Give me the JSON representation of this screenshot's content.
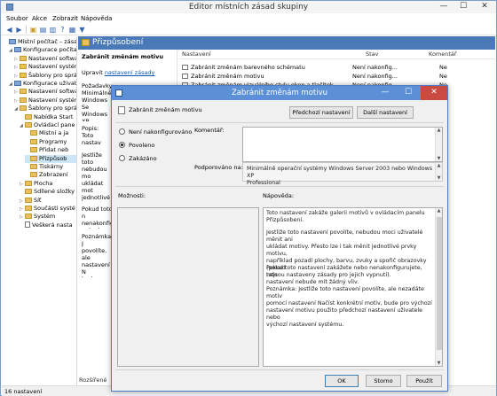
{
  "app": {
    "title": "Editor místních zásad skupiny",
    "controls": {
      "minimize": "—",
      "maximize": "☐",
      "close": "✕"
    }
  },
  "menu": [
    "Soubor",
    "Akce",
    "Zobrazit",
    "Nápověda"
  ],
  "toolbar": {
    "icons": [
      "back-icon",
      "forward-icon",
      "folder-up-icon",
      "show-hide-tree-icon",
      "export-icon",
      "help-icon",
      "properties-icon",
      "filter-icon"
    ]
  },
  "tree": {
    "items": [
      {
        "label": "Místní počítač – zásady",
        "indent": 0,
        "expander": "",
        "icon": "computer"
      },
      {
        "label": "Konfigurace počítač",
        "indent": 1,
        "expander": "◢",
        "icon": "computer"
      },
      {
        "label": "Nastavení softwa",
        "indent": 2,
        "expander": "▷",
        "icon": "folder"
      },
      {
        "label": "Nastavení systém",
        "indent": 2,
        "expander": "▷",
        "icon": "folder"
      },
      {
        "label": "Šablony pro sprá",
        "indent": 2,
        "expander": "▷",
        "icon": "folder"
      },
      {
        "label": "Konfigurace uživatele",
        "indent": 1,
        "expander": "◢",
        "icon": "computer"
      },
      {
        "label": "Nastavení softwa",
        "indent": 2,
        "expander": "▷",
        "icon": "folder"
      },
      {
        "label": "Nastavení systém",
        "indent": 2,
        "expander": "▷",
        "icon": "folder"
      },
      {
        "label": "Šablony pro sprá",
        "indent": 2,
        "expander": "◢",
        "icon": "folder"
      },
      {
        "label": "Nabídka Start",
        "indent": 3,
        "expander": "",
        "icon": "folder"
      },
      {
        "label": "Ovládací pane",
        "indent": 3,
        "expander": "◢",
        "icon": "folder"
      },
      {
        "label": "Místní a ja",
        "indent": 4,
        "expander": "",
        "icon": "folder"
      },
      {
        "label": "Programy",
        "indent": 4,
        "expander": "",
        "icon": "folder"
      },
      {
        "label": "Přidat neb",
        "indent": 4,
        "expander": "",
        "icon": "folder"
      },
      {
        "label": "Přizpůsob",
        "indent": 4,
        "expander": "",
        "icon": "folder",
        "selected": true
      },
      {
        "label": "Tiskárny",
        "indent": 4,
        "expander": "",
        "icon": "folder"
      },
      {
        "label": "Zobrazení",
        "indent": 4,
        "expander": "",
        "icon": "folder"
      },
      {
        "label": "Plocha",
        "indent": 3,
        "expander": "▷",
        "icon": "folder"
      },
      {
        "label": "Sdílené složky",
        "indent": 3,
        "expander": "",
        "icon": "folder"
      },
      {
        "label": "Síť",
        "indent": 3,
        "expander": "▷",
        "icon": "folder"
      },
      {
        "label": "Součásti systé",
        "indent": 3,
        "expander": "▷",
        "icon": "folder"
      },
      {
        "label": "Systém",
        "indent": 3,
        "expander": "▷",
        "icon": "folder"
      },
      {
        "label": "Veškerá nasta",
        "indent": 3,
        "expander": "",
        "icon": "doc"
      }
    ]
  },
  "pane": {
    "header": "Přizpůsobení",
    "desc_title": "Zabránit změnám motivu",
    "desc_link_prefix": "Upravit ",
    "desc_link": "nastavení zásady",
    "desc_requirements": "Požadavky:\nMinimálně\nWindows Se\nWindows XP\nProfessiona",
    "desc_popis": "Popis:\nToto nastav\nv ovládacím",
    "desc_more": "Jestliže toto\nnebudou mo\nukládat mot\njednotlivé p\npozadí ploch\nobrazovky (\nzásady pro j",
    "desc_more2": "Pokud toto n\nnenakonfigu\nnebude mít",
    "desc_note": "Poznámka: J\npovolíte, ale\nnastavení N\nbude pro vý\npoužito přec\nnebo výchoz",
    "columns": {
      "setting": "Nastavení",
      "state": "Stav",
      "comment": "Komentář"
    },
    "rows": [
      {
        "setting": "Zabránit změnám barevného schématu",
        "state": "Není nakonfig...",
        "comment": "Ne"
      },
      {
        "setting": "Zabránit změnám motivu",
        "state": "Není nakonfig...",
        "comment": "Ne"
      },
      {
        "setting": "Zabránit změnám vizuálního stylu oken a tlačítek",
        "state": "Není nakonfig...",
        "comment": "Ne"
      }
    ],
    "bottom_tab": "Rozšířené"
  },
  "status": "16 nastavení",
  "dialog": {
    "title": "Zabránit změnám motivu",
    "subtitle": "Zabránit změnám motivu",
    "btn_prev": "Předchozí nastavení",
    "btn_next": "Další nastavení",
    "radio_not_configured": "Není nakonfigurováno",
    "radio_enabled": "Povoleno",
    "radio_disabled": "Zakázáno",
    "selected_radio": "Povoleno",
    "comment_label": "Komentář:",
    "supported_label": "Podporováno na:",
    "supported_text": "Minimálně operační systémy Windows Server 2003 nebo Windows XP\nProfessional",
    "options_label": "Možnosti:",
    "help_label": "Nápověda:",
    "help_text_1": "Toto nastavení zakáže galerii motivů v ovládacím panelu\nPřizpůsobení.",
    "help_text_2": "Jestliže toto nastavení povolíte, nebudou moci uživatelé měnit ani\nukládat motivy.  Přesto lze i tak měnit jednotlivé prvky motivu,\nnapříklad pozadí plochy, barvu, zvuky a spořič obrazovky (pokud\nnejsou nastaveny zásady pro jejich vypnutí).",
    "help_text_3": "Pokud toto nastavení zakážete nebo nenakonfigurujete, toto\nnastavení nebude mít žádný vliv.",
    "help_text_4": "Poznámka: Jestliže toto nastavení povolíte, ale nezadáte motiv\npomocí nastavení Načíst konkrétní motiv, bude pro výchozí\nnastavení motivu použito předchozí nastavení uživatele nebo\nvýchozí nastavení systému.",
    "btn_ok": "OK",
    "btn_cancel": "Storno",
    "btn_apply": "Použít"
  }
}
